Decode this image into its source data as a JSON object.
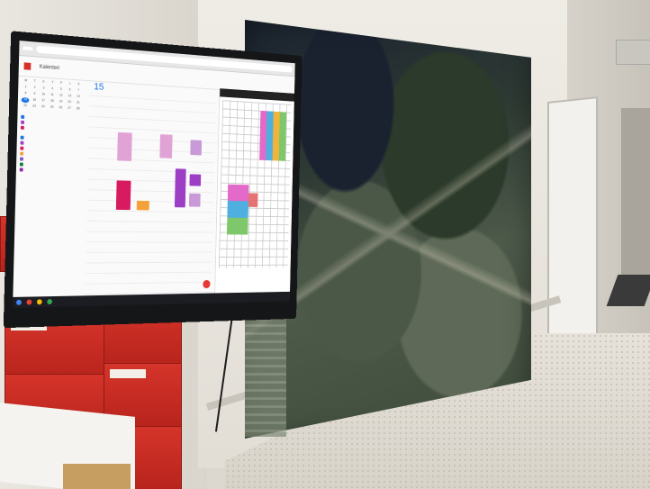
{
  "screen": {
    "browser_tab": "",
    "app_logo_text": "",
    "app_title": "Kalenteri",
    "date_heading": "",
    "day_number": "15",
    "mini_calendar": [
      "M",
      "T",
      "K",
      "T",
      "P",
      "L",
      "S",
      "1",
      "2",
      "3",
      "4",
      "5",
      "6",
      "7",
      "8",
      "9",
      "10",
      "11",
      "12",
      "13",
      "14",
      "15",
      "16",
      "17",
      "18",
      "19",
      "20",
      "21",
      "22",
      "23",
      "24",
      "25",
      "26",
      "27",
      "28"
    ],
    "calendar_columns": [
      "",
      "",
      "",
      "",
      ""
    ],
    "sections": [
      {
        "title": "",
        "items": [
          "",
          "",
          ""
        ]
      },
      {
        "title": "",
        "items": [
          "",
          "",
          "",
          "",
          "",
          "",
          ""
        ]
      }
    ],
    "colors": {
      "primary_blue": "#1a73e8",
      "event_pink": "#e1a3d6",
      "event_red": "#d81b60",
      "event_purple": "#9c3fc5",
      "event_orange": "#f4a13a",
      "brand_red": "#c62828"
    }
  }
}
